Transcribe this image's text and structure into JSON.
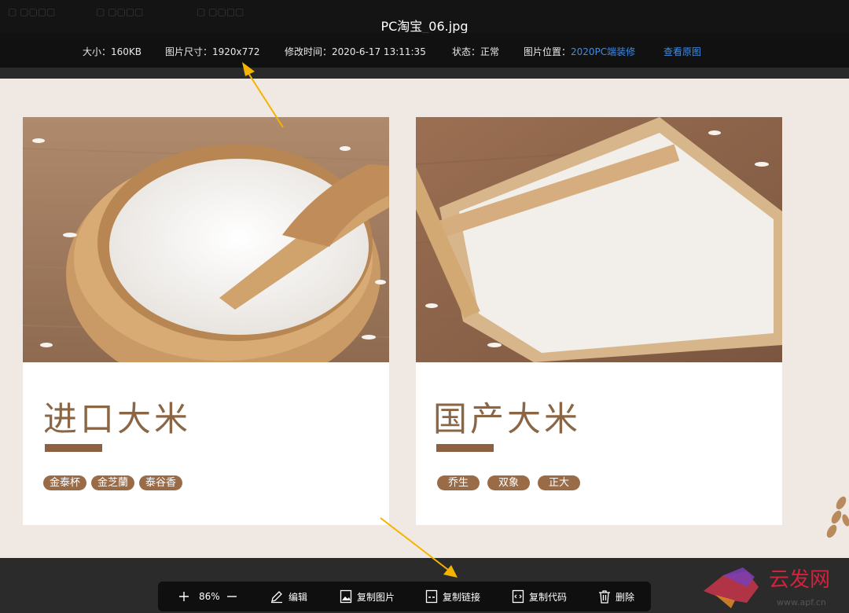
{
  "viewer": {
    "filename": "PC淘宝_06.jpg",
    "info": {
      "size_label": "大小：",
      "size_value": "160KB",
      "dims_label": "图片尺寸：",
      "dims_value": "1920x772",
      "mtime_label": "修改时间：",
      "mtime_value": "2020-6-17 13:11:35",
      "status_label": "状态：",
      "status_value": "正常",
      "location_label": "图片位置：",
      "location_value": "2020PC端装修",
      "view_original": "查看原图"
    }
  },
  "image": {
    "cards": [
      {
        "title": "进口大米",
        "tags": [
          "金泰杯",
          "金芝蘭",
          "泰谷香"
        ]
      },
      {
        "title": "国产大米",
        "tags": [
          "乔生",
          "双象",
          "正大"
        ]
      }
    ]
  },
  "toolbar": {
    "zoom": "86%",
    "edit": "编辑",
    "copy_image": "复制图片",
    "copy_link": "复制链接",
    "copy_code": "复制代码",
    "delete": "删除"
  },
  "icons": {
    "zoom_in": "plus-icon",
    "zoom_out": "minus-icon",
    "edit": "pencil-icon",
    "copy_image": "image-icon",
    "copy_link": "link-icon",
    "copy_code": "code-icon",
    "delete": "trash-icon"
  },
  "watermark": {
    "brand": "云发网",
    "url": "www.apf.cn"
  },
  "colors": {
    "accent_link": "#3f8ce6",
    "heading_brown": "#8a6645",
    "tag_brown": "#9a6b47",
    "annotation_arrow": "#f4b400"
  }
}
